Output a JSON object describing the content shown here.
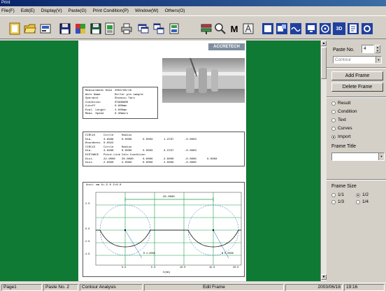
{
  "window": {
    "title": "Print"
  },
  "menu": {
    "items": [
      "File(F)",
      "Edit(E)",
      "Display(V)",
      "Paste(G)",
      "Print Condition(P)",
      "Window(W)",
      "Others(O)"
    ]
  },
  "toolbar": {
    "m_label": "M",
    "threed_label": "3D",
    "icons": [
      "new-icon",
      "open-icon",
      "print-setup-icon",
      "save-icon",
      "color-icon",
      "save-as-icon",
      "grid-icon",
      "print-icon",
      "window-icon",
      "tile-icon",
      "frame-icon",
      "layout-icon",
      "zoom-icon",
      "m-mode-icon",
      "a-mode-icon",
      "display-icon",
      "tool-icon",
      "wave-icon",
      "monitor-icon",
      "target-icon",
      "three-d-icon",
      "report-icon",
      "settings-icon"
    ]
  },
  "document": {
    "brand": "ACCRETECH",
    "meta_rows": [
      [
        "Measurement Date",
        "2003/06/18"
      ],
      [
        "Work Name",
        "Roller pin sample"
      ],
      [
        "Operator",
        "Shimizu Taro"
      ],
      [
        "Condition",
        "STANDARD"
      ],
      [
        "Cutoff",
        "0.800mm"
      ],
      [
        "Eval. Length",
        "4.000mm"
      ],
      [
        "Meas. Speed",
        "0.30mm/s"
      ]
    ],
    "result_rows": [
      [
        "CIRCLE",
        "Circle",
        "Radius",
        "",
        "",
        ""
      ],
      [
        "Dia.",
        "3.9998",
        "0.0000",
        "X.0003",
        "1.3797",
        "-0.0003",
        ""
      ],
      [
        "Roundness",
        "0.0022",
        "",
        "",
        "",
        "",
        ""
      ],
      [
        "CIRCLE",
        "Circle",
        "Radius",
        "",
        "",
        ""
      ],
      [
        "Dia.",
        "3.9996",
        "0.0000",
        "X.0003",
        "3.3797",
        "-0.0003",
        ""
      ],
      [
        "DISTANCE",
        "Point-Line",
        "Calc.Condition",
        "",
        "",
        ""
      ],
      [
        "Dist.",
        "22.0000",
        "20.0000",
        "0.0000",
        "2.0000",
        "-0.0000",
        "0.0000"
      ],
      [
        "Dist.",
        "2.0000",
        "2.0000",
        "0.0000",
        "2.0000",
        "-0.0000",
        ""
      ]
    ],
    "chart_header": "Unit: mm    X=-5.0  Z=0.0",
    "x_ticks": [
      "0.0",
      "5.0",
      "10.0",
      "15.0",
      "20.0"
    ],
    "x_label": "X(mm)",
    "y_ticks": [
      "2.0",
      "0.0",
      "-2.0",
      "-4.0"
    ],
    "dim_label": "20.0000",
    "r_label_left": "R 2.0000",
    "r_label_right": "R 2.0000"
  },
  "panel": {
    "paste_no_label": "Paste No.",
    "paste_no_value": "4",
    "paste_type": "Contour",
    "add_frame": "Add Frame",
    "delete_frame": "Delete Frame",
    "radio_options": [
      "Result",
      "Condition",
      "Text",
      "Curves",
      "Import"
    ],
    "radio_selected": "Import",
    "frame_title_label": "Frame Title",
    "frame_title_value": "",
    "frame_size_label": "Frame Size",
    "size_options": [
      "1/1",
      "1/2",
      "1/3",
      "1/4"
    ],
    "size_selected": "1/2"
  },
  "status": {
    "page": "Page1",
    "paste_no": "Paste No. 2",
    "mode": "Contour Analysis",
    "action": "Edit Frame",
    "date": "2003/06/18",
    "time": "19:16"
  },
  "colors": {
    "workspace": "#0f7a34",
    "chrome": "#d4d0c8",
    "plot_grid": "#1e9e4a",
    "plot_curve": "#1a5fb0"
  }
}
